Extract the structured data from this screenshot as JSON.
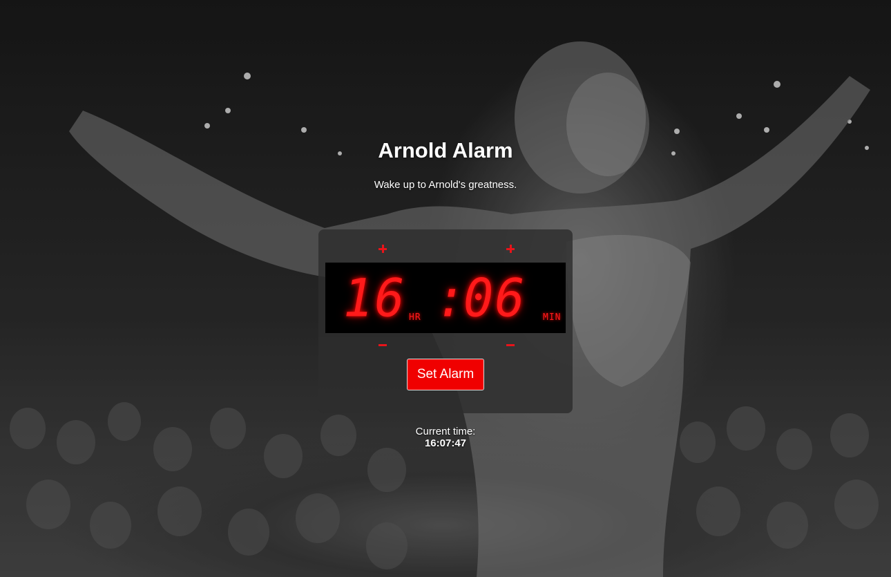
{
  "app": {
    "title": "Arnold Alarm",
    "subtitle": "Wake up to Arnold's greatness."
  },
  "alarm": {
    "hours": "16",
    "separator": ":",
    "minutes": "06",
    "hours_unit": "HR",
    "minutes_unit": "MIN",
    "increment_symbol": "+",
    "decrement_symbol": "−"
  },
  "actions": {
    "set_alarm_label": "Set Alarm"
  },
  "clock": {
    "label": "Current time:",
    "time": "16:07:47"
  },
  "colors": {
    "accent": "#f00000",
    "display_digits": "#ff1a1a",
    "display_bg": "#000000",
    "panel_bg": "rgba(45,45,45,0.82)"
  },
  "background": {
    "description_icon": "bodybuilder-photo-bw"
  }
}
